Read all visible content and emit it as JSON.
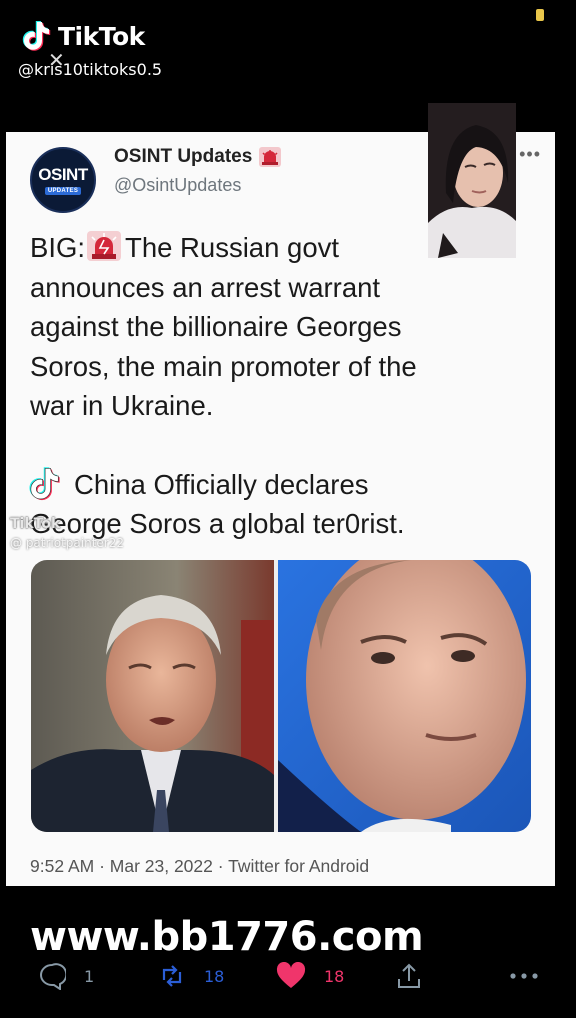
{
  "tiktok": {
    "brand": "TikTok",
    "handle": "@kris10tiktoks0.5",
    "watermark_label": "TikTok",
    "watermark_handle": "@ patriotpainter22"
  },
  "tweet": {
    "author_name": "OSINT Updates",
    "author_handle": "@OsintUpdates",
    "avatar_text": "OSINT",
    "avatar_subtext": "UPDATES",
    "line_1_prefix": "BIG:",
    "line_1_rest": "The Russian govt",
    "lines": [
      "announces an arrest warrant",
      "against the billionaire Georges",
      "Soros, the main promoter of the",
      "war in Ukraine."
    ],
    "line_china_1": "China Officially declares",
    "line_china_2": "George Soros a global ter0rist.",
    "timestamp": "9:52 AM · Mar 23, 2022 · Twitter for Android"
  },
  "overlay_site": "www.bb1776.com",
  "actions": {
    "replies": "1",
    "retweets": "18",
    "likes": "18"
  },
  "colors": {
    "retweet": "#2b5ed6",
    "like": "#f0356b",
    "siren": "#d4283a"
  },
  "icons": [
    "tiktok-logo-icon",
    "close-icon",
    "siren-icon",
    "more-icon",
    "reply-icon",
    "retweet-icon",
    "heart-icon",
    "share-icon",
    "more-horizontal-icon"
  ]
}
